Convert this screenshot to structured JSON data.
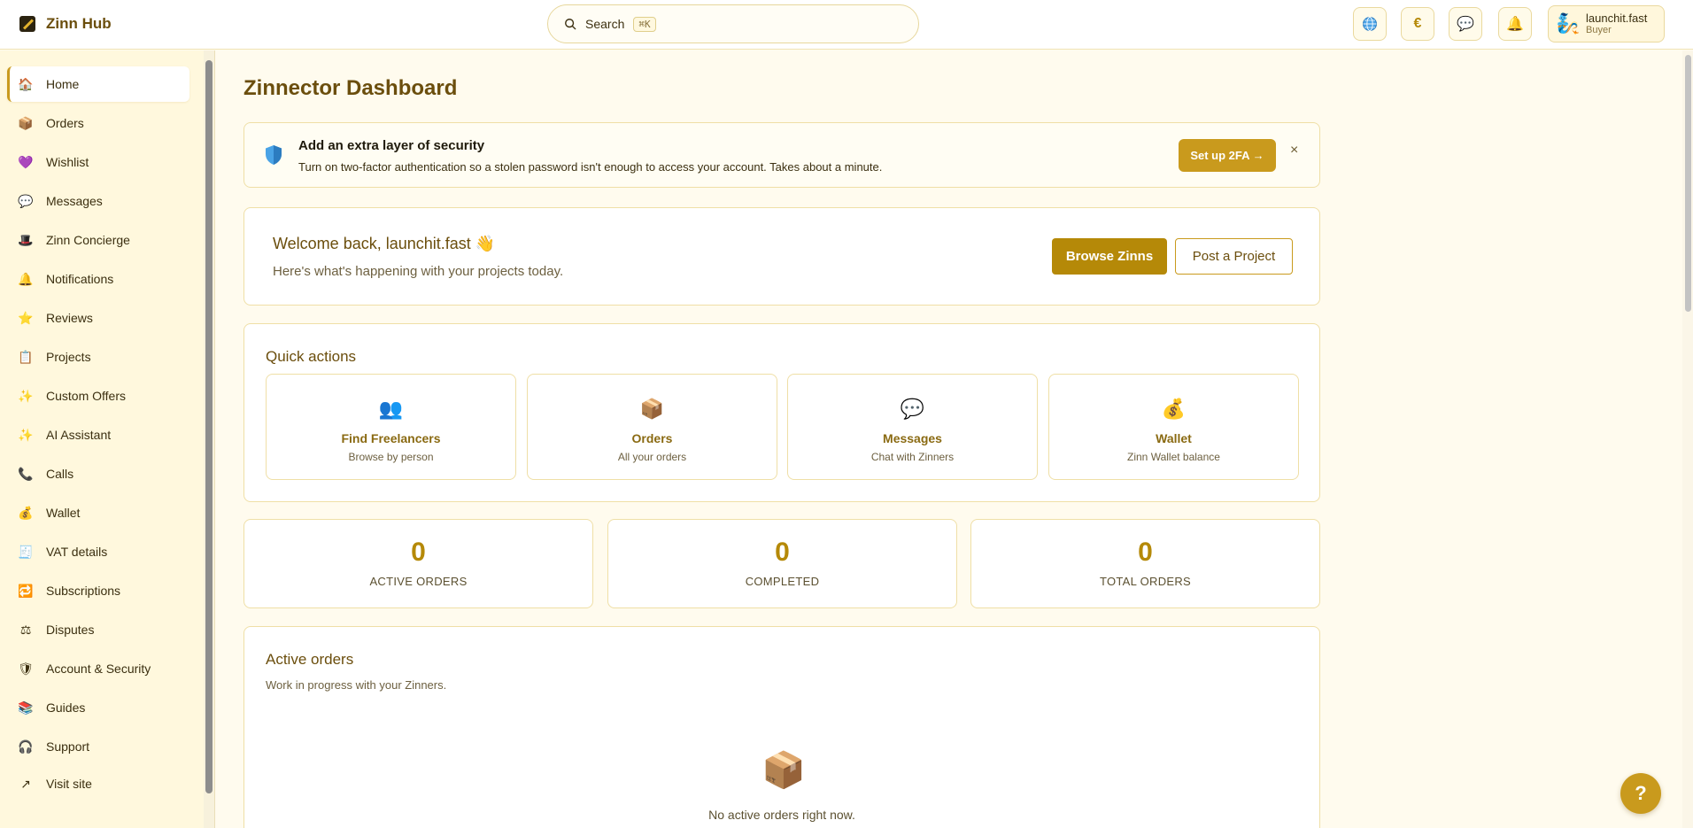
{
  "header": {
    "brand": "Zinn Hub",
    "search_label": "Search",
    "search_shortcut": "⌘K",
    "user_name": "launchit.fast",
    "user_role": "Buyer",
    "icons": [
      "globe-icon",
      "euro-icon",
      "chat-icon",
      "bell-icon"
    ],
    "currency_symbol": "€"
  },
  "sidebar": {
    "items": [
      {
        "label": "Home",
        "icon": "🏠"
      },
      {
        "label": "Orders",
        "icon": "📦"
      },
      {
        "label": "Wishlist",
        "icon": "💜"
      },
      {
        "label": "Messages",
        "icon": "💬"
      },
      {
        "label": "Zinn Concierge",
        "icon": "🎩"
      },
      {
        "label": "Notifications",
        "icon": "🔔"
      },
      {
        "label": "Reviews",
        "icon": "⭐"
      },
      {
        "label": "Projects",
        "icon": "📋"
      },
      {
        "label": "Custom Offers",
        "icon": "✨"
      },
      {
        "label": "AI Assistant",
        "icon": "✨"
      },
      {
        "label": "Calls",
        "icon": "📞"
      },
      {
        "label": "Wallet",
        "icon": "💰"
      },
      {
        "label": "VAT details",
        "icon": "🧾"
      },
      {
        "label": "Subscriptions",
        "icon": "🔁"
      },
      {
        "label": "Disputes",
        "icon": "⚖"
      },
      {
        "label": "Account & Security",
        "icon": "🛡"
      },
      {
        "label": "Guides",
        "icon": "📚"
      },
      {
        "label": "Support",
        "icon": "🎧"
      },
      {
        "label": "Visit site",
        "icon": "↗"
      }
    ],
    "active": "Home"
  },
  "main": {
    "title": "Zinnector Dashboard",
    "security_banner": {
      "title": "Add an extra layer of security",
      "text": "Turn on two-factor authentication so a stolen password isn't enough to access your account. Takes about a minute.",
      "button": "Set up 2FA →",
      "close": "×"
    },
    "welcome": {
      "title": "Welcome back, launchit.fast 👋",
      "subtitle": "Here's what's happening with your projects today.",
      "browse_button": "Browse Zinns",
      "post_button": "Post a Project"
    },
    "quick_actions": {
      "title": "Quick actions",
      "items": [
        {
          "title": "Find Freelancers",
          "subtitle": "Browse by person",
          "icon": "👥"
        },
        {
          "title": "Orders",
          "subtitle": "All your orders",
          "icon": "📦"
        },
        {
          "title": "Messages",
          "subtitle": "Chat with Zinners",
          "icon": "💬"
        },
        {
          "title": "Wallet",
          "subtitle": "Zinn Wallet balance",
          "icon": "💰"
        }
      ]
    },
    "stats": [
      {
        "value": "0",
        "label": "ACTIVE ORDERS"
      },
      {
        "value": "0",
        "label": "COMPLETED"
      },
      {
        "value": "0",
        "label": "TOTAL ORDERS"
      }
    ],
    "active_orders": {
      "title": "Active orders",
      "subtitle": "Work in progress with your Zinners.",
      "empty_icon": "📦",
      "empty_text": "No active orders right now."
    },
    "help_button": "?"
  },
  "colors": {
    "accent": "#c99a1d",
    "accent_dark": "#b58908",
    "title": "#6b4e0d",
    "background": "#fffbee",
    "sidebar": "#fff8dd"
  }
}
